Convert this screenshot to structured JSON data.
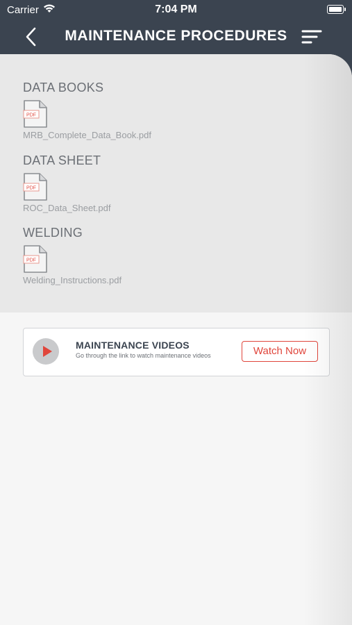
{
  "status_bar": {
    "carrier": "Carrier",
    "time": "7:04 PM"
  },
  "header": {
    "title": "MAINTENANCE PROCEDURES"
  },
  "groups": [
    {
      "heading": "DATA BOOKS",
      "file": "MRB_Complete_Data_Book.pdf",
      "file_icon_text": "PDF"
    },
    {
      "heading": "DATA SHEET",
      "file": "ROC_Data_Sheet.pdf",
      "file_icon_text": "PDF"
    },
    {
      "heading": "WELDING",
      "file": "Welding_Instructions.pdf",
      "file_icon_text": "PDF"
    }
  ],
  "video_card": {
    "title": "MAINTENANCE VIDEOS",
    "description": "Go through the link to watch maintenance videos",
    "button_label": "Watch Now"
  },
  "colors": {
    "header_bg": "#3b4450",
    "accent": "#e0453b",
    "section_bg": "#e8e8e8"
  },
  "icons": [
    "wifi-icon",
    "battery-icon",
    "back-arrow-icon",
    "menu-icon",
    "pdf-file-icon",
    "play-icon"
  ]
}
